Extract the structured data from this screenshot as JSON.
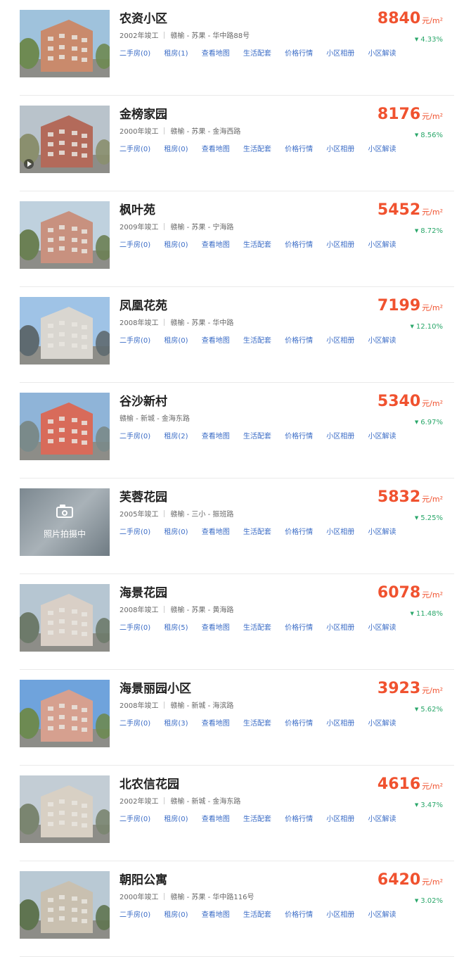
{
  "colors": {
    "price": "#f0522f",
    "change": "#2aa76a",
    "link": "#3b6cc6"
  },
  "links": [
    "二手房",
    "租房",
    "查看地图",
    "生活配套",
    "价格行情",
    "小区相册",
    "小区解读"
  ],
  "unit": "元/m²",
  "listings": [
    {
      "name": "农资小区",
      "year": "2002年竣工",
      "location": "赣榆 - 苏果 - 华中路88号",
      "second_hand": "二手房(0)",
      "rent": "租房(1)",
      "price": "8840",
      "change": "4.33%",
      "photo": "building"
    },
    {
      "name": "金榜家园",
      "year": "2000年竣工",
      "location": "赣榆 - 苏果 - 金海西路",
      "second_hand": "二手房(0)",
      "rent": "租房(0)",
      "price": "8176",
      "change": "8.56%",
      "photo": "building"
    },
    {
      "name": "枫叶苑",
      "year": "2009年竣工",
      "location": "赣榆 - 苏果 - 宁海路",
      "second_hand": "二手房(0)",
      "rent": "租房(0)",
      "price": "5452",
      "change": "8.72%",
      "photo": "building"
    },
    {
      "name": "凤凰花苑",
      "year": "2008年竣工",
      "location": "赣榆 - 苏果 - 华中路",
      "second_hand": "二手房(0)",
      "rent": "租房(0)",
      "price": "7199",
      "change": "12.10%",
      "photo": "building"
    },
    {
      "name": "谷沙新村",
      "year": "",
      "location": "赣榆 - 新城 - 金海东路",
      "second_hand": "二手房(0)",
      "rent": "租房(2)",
      "price": "5340",
      "change": "6.97%",
      "photo": "building"
    },
    {
      "name": "芙蓉花园",
      "year": "2005年竣工",
      "location": "赣榆 - 三小 - 振班路",
      "second_hand": "二手房(0)",
      "rent": "租房(0)",
      "price": "5832",
      "change": "5.25%",
      "photo": "placeholder",
      "placeholder_text": "照片拍摄中"
    },
    {
      "name": "海景花园",
      "year": "2008年竣工",
      "location": "赣榆 - 苏果 - 黄海路",
      "second_hand": "二手房(0)",
      "rent": "租房(5)",
      "price": "6078",
      "change": "11.48%",
      "photo": "building"
    },
    {
      "name": "海景丽园小区",
      "year": "2008年竣工",
      "location": "赣榆 - 新城 - 海滨路",
      "second_hand": "二手房(0)",
      "rent": "租房(3)",
      "price": "3923",
      "change": "5.62%",
      "photo": "building"
    },
    {
      "name": "北农信花园",
      "year": "2002年竣工",
      "location": "赣榆 - 新城 - 金海东路",
      "second_hand": "二手房(0)",
      "rent": "租房(0)",
      "price": "4616",
      "change": "3.47%",
      "photo": "building"
    },
    {
      "name": "朝阳公寓",
      "year": "2000年竣工",
      "location": "赣榆 - 苏果 - 华中路116号",
      "second_hand": "二手房(0)",
      "rent": "租房(0)",
      "price": "6420",
      "change": "3.02%",
      "photo": "building"
    }
  ]
}
